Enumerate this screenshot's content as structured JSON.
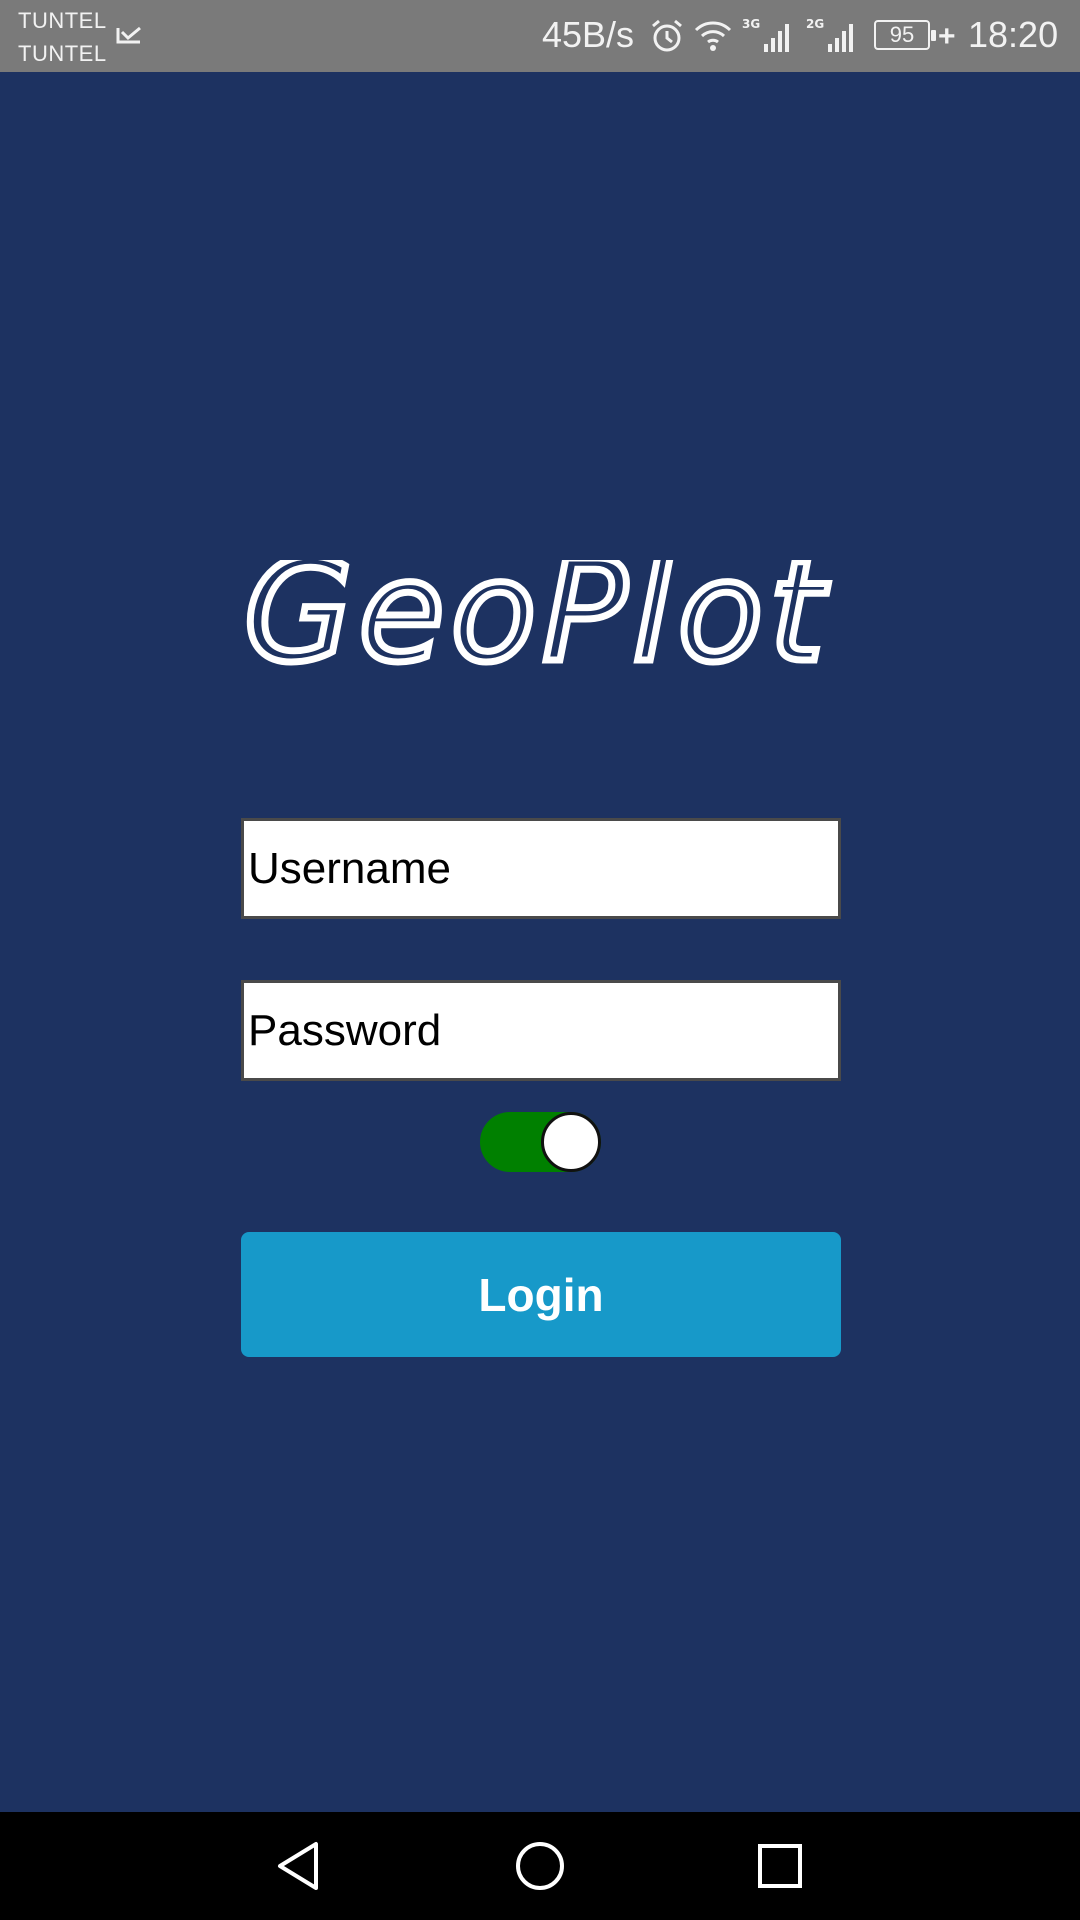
{
  "status_bar": {
    "carrier_1": "TUNTEL",
    "carrier_2": "TUNTEL",
    "net_speed": "45B/s",
    "sig_3g": "3G",
    "sig_2g": "2G",
    "battery_level": "95",
    "time": "18:20",
    "icons": [
      "carrier-data-icon",
      "alarm-icon",
      "wifi-icon",
      "signal-3g-icon",
      "signal-2g-icon",
      "battery-icon",
      "charging-icon"
    ]
  },
  "app": {
    "logo": "GeoPlot"
  },
  "login_form": {
    "username_placeholder": "Username",
    "password_placeholder": "Password",
    "remember_toggle_on": true,
    "login_label": "Login"
  },
  "nav_bar": {
    "icons": [
      "back-icon",
      "home-icon",
      "recents-icon"
    ]
  },
  "colors": {
    "background": "#1d3261",
    "status_bar": "#7a7a7a",
    "button": "#1799c9",
    "toggle_on": "#008000",
    "nav_bar": "#000000"
  }
}
